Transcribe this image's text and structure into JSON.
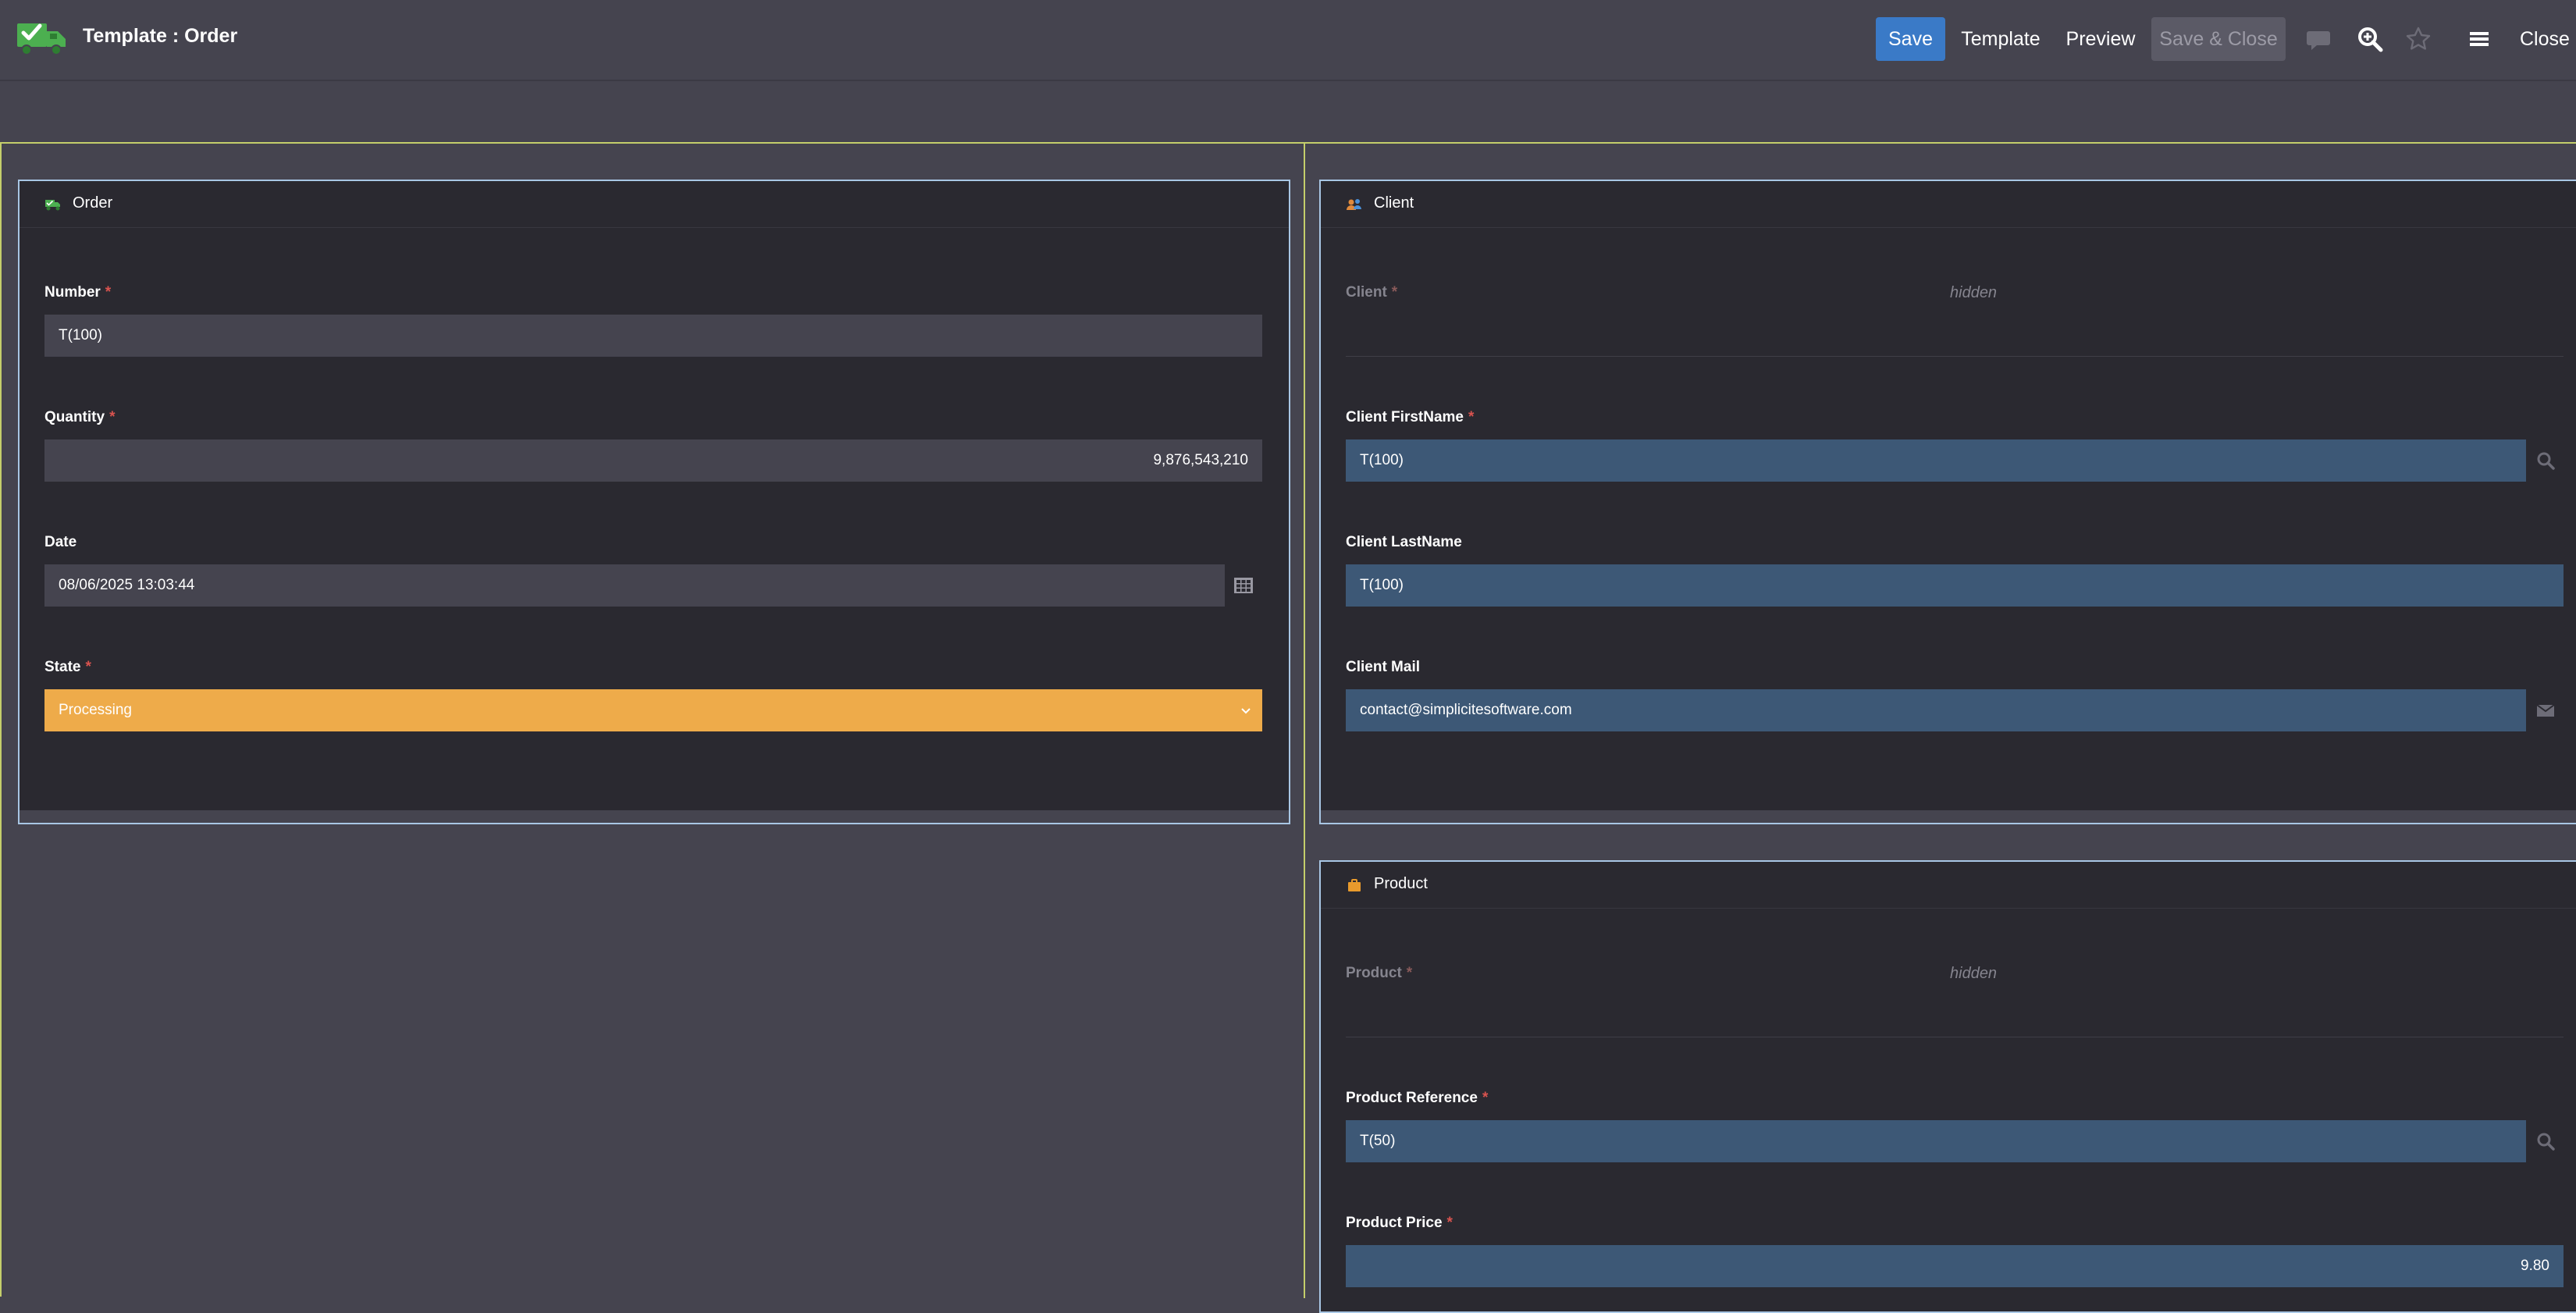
{
  "header": {
    "title": "Template : Order",
    "buttons": {
      "save": "Save",
      "template": "Template",
      "preview": "Preview",
      "save_close": "Save & Close",
      "close": "Close"
    },
    "icons": [
      "chat-icon",
      "zoom-icon",
      "star-icon",
      "menu-icon"
    ]
  },
  "order_panel": {
    "title": "Order",
    "icon": "order-truck-icon",
    "fields": {
      "number": {
        "label": "Number",
        "required": "*",
        "value": "T(100)"
      },
      "quantity": {
        "label": "Quantity",
        "required": "*",
        "value": "9,876,543,210"
      },
      "date": {
        "label": "Date",
        "value": "08/06/2025 13:03:44"
      },
      "state": {
        "label": "State",
        "required": "*",
        "value": "Processing"
      }
    }
  },
  "client_panel": {
    "title": "Client",
    "icon": "client-users-icon",
    "fields": {
      "client": {
        "label": "Client",
        "required": "*",
        "note": "hidden"
      },
      "first_name": {
        "label": "Client FirstName",
        "required": "*",
        "value": "T(100)"
      },
      "last_name": {
        "label": "Client LastName",
        "value": "T(100)"
      },
      "mail": {
        "label": "Client Mail",
        "value": "contact@simplicitesoftware.com"
      }
    }
  },
  "product_panel": {
    "title": "Product",
    "icon": "product-box-icon",
    "fields": {
      "product": {
        "label": "Product",
        "required": "*",
        "note": "hidden"
      },
      "reference": {
        "label": "Product Reference",
        "required": "*",
        "value": "T(50)"
      },
      "price": {
        "label": "Product Price",
        "required": "*",
        "value": "9.80"
      }
    }
  },
  "colors": {
    "background": "#45444f",
    "panel": "#2a2930",
    "panel_border": "#a8c6e4",
    "workarea_border": "#c4ce6b",
    "primary": "#3a7ac7",
    "state_processing": "#eeab4a",
    "reference_field": "#3d5876",
    "required": "#d9534f"
  }
}
